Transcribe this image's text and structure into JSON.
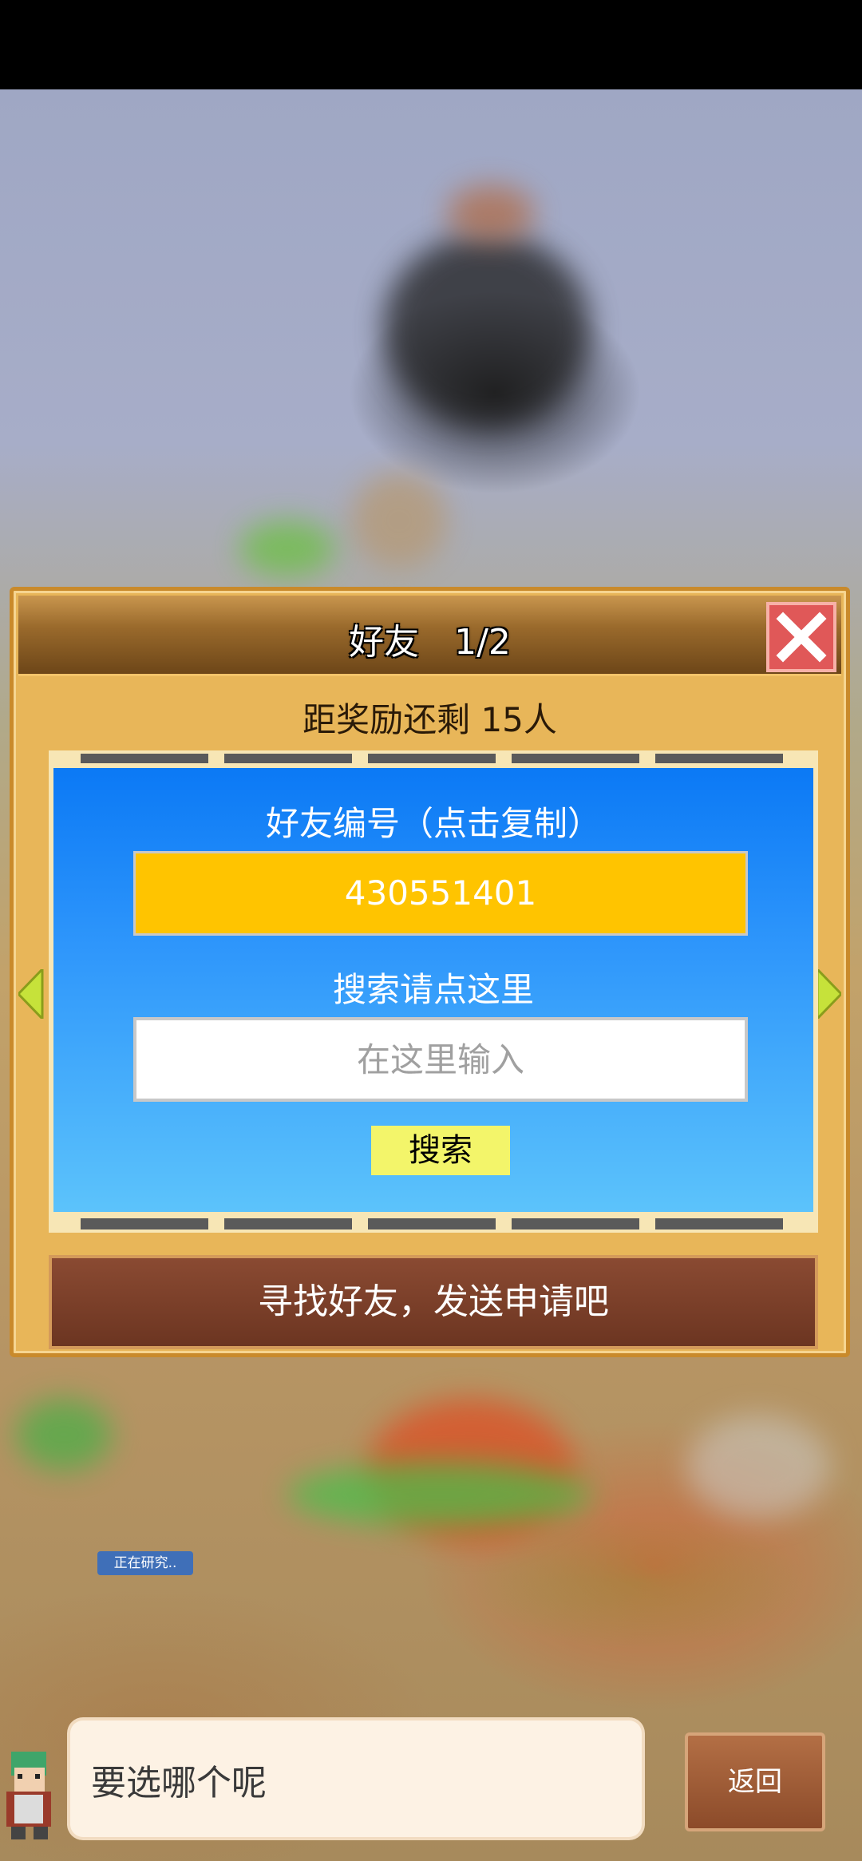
{
  "dialog": {
    "title": "好友　1/2",
    "reward_line": "距奖励还剩 15人",
    "friend_id_label": "好友编号（点击复制）",
    "friend_id": "430551401",
    "search_label": "搜索请点这里",
    "search_placeholder": "在这里输入",
    "search_button": "搜索",
    "find_friends_button": "寻找好友，发送申请吧"
  },
  "background": {
    "research_tag": "正在研究.."
  },
  "bottom": {
    "prompt_text": "要选哪个呢",
    "back_button": "返回"
  },
  "colors": {
    "panel_blue": "#0b79f5",
    "friend_id_bg": "#ffc400",
    "search_button_bg": "#f3f56a",
    "close_button_bg": "#e05858"
  }
}
